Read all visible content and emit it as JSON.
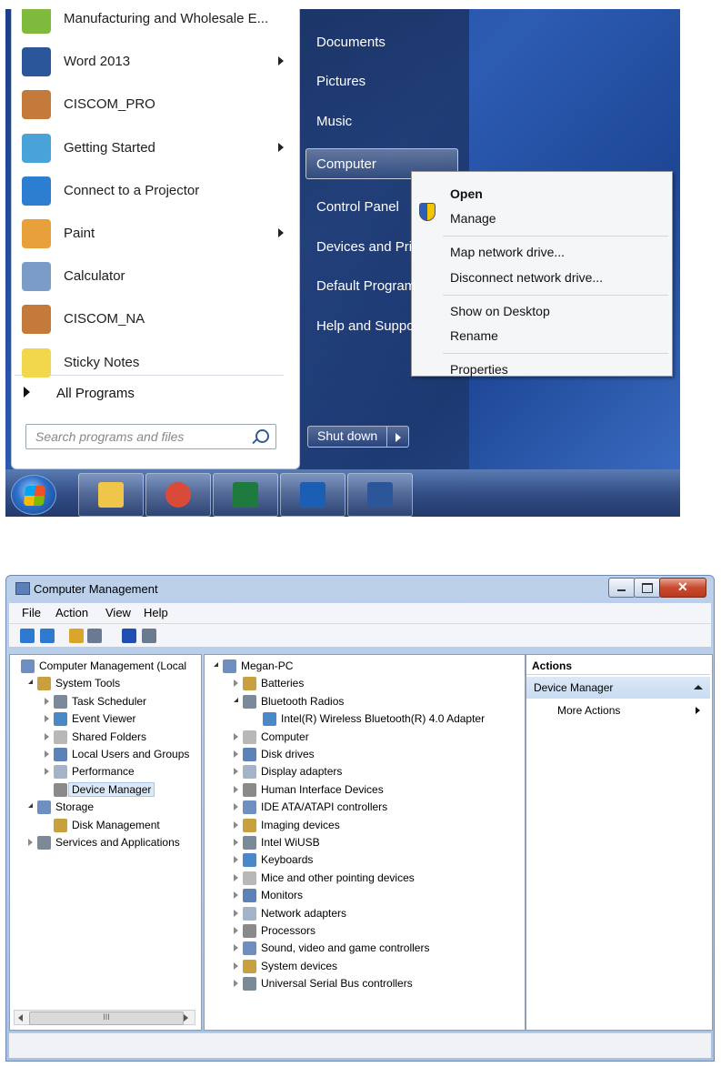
{
  "start_menu": {
    "programs": [
      {
        "label": "Manufacturing and Wholesale E...",
        "icon": "manufacturing-app-icon",
        "arrow": false
      },
      {
        "label": "Word 2013",
        "icon": "word-icon",
        "arrow": true
      },
      {
        "label": "CISCOM_PRO",
        "icon": "ciscom-pro-icon",
        "arrow": false
      },
      {
        "label": "Getting Started",
        "icon": "getting-started-icon",
        "arrow": true
      },
      {
        "label": "Connect to a Projector",
        "icon": "projector-icon",
        "arrow": false
      },
      {
        "label": "Paint",
        "icon": "paint-icon",
        "arrow": true
      },
      {
        "label": "Calculator",
        "icon": "calculator-icon",
        "arrow": false
      },
      {
        "label": "CISCOM_NA",
        "icon": "ciscom-na-icon",
        "arrow": false
      },
      {
        "label": "Sticky Notes",
        "icon": "sticky-notes-icon",
        "arrow": false
      }
    ],
    "all_programs": "All Programs",
    "search_placeholder": "Search programs and files",
    "right_items": [
      "Documents",
      "Pictures",
      "Music",
      "Computer",
      "Control Panel",
      "Devices and Pri",
      "Default Program",
      "Help and Suppo"
    ],
    "shutdown": "Shut down"
  },
  "context_menu": {
    "items": [
      "Open",
      "Manage",
      "Map network drive...",
      "Disconnect network drive...",
      "Show on Desktop",
      "Rename",
      "Properties"
    ]
  },
  "taskbar": {
    "icons": [
      "start-orb-icon",
      "file-explorer-icon",
      "chrome-icon",
      "excel-icon",
      "outlook-icon",
      "word-icon"
    ]
  },
  "computer_management": {
    "title": "Computer Management",
    "menu": [
      "File",
      "Action",
      "View",
      "Help"
    ],
    "tree": [
      {
        "label": "Computer Management (Local",
        "level": 0,
        "exp": "none"
      },
      {
        "label": "System Tools",
        "level": 1,
        "exp": "open"
      },
      {
        "label": "Task Scheduler",
        "level": 2,
        "exp": "closed"
      },
      {
        "label": "Event Viewer",
        "level": 2,
        "exp": "closed"
      },
      {
        "label": "Shared Folders",
        "level": 2,
        "exp": "closed"
      },
      {
        "label": "Local Users and Groups",
        "level": 2,
        "exp": "closed"
      },
      {
        "label": "Performance",
        "level": 2,
        "exp": "closed"
      },
      {
        "label": "Device Manager",
        "level": 2,
        "exp": "none",
        "selected": true
      },
      {
        "label": "Storage",
        "level": 1,
        "exp": "open"
      },
      {
        "label": "Disk Management",
        "level": 2,
        "exp": "none"
      },
      {
        "label": "Services and Applications",
        "level": 1,
        "exp": "closed"
      }
    ],
    "scroll_label": "III",
    "devices": [
      {
        "label": "Megan-PC",
        "level": 0,
        "exp": "open"
      },
      {
        "label": "Batteries",
        "level": 1,
        "exp": "closed"
      },
      {
        "label": "Bluetooth Radios",
        "level": 1,
        "exp": "open"
      },
      {
        "label": "Intel(R) Wireless Bluetooth(R) 4.0 Adapter",
        "level": 2,
        "exp": "none"
      },
      {
        "label": "Computer",
        "level": 1,
        "exp": "closed"
      },
      {
        "label": "Disk drives",
        "level": 1,
        "exp": "closed"
      },
      {
        "label": "Display adapters",
        "level": 1,
        "exp": "closed"
      },
      {
        "label": "Human Interface Devices",
        "level": 1,
        "exp": "closed"
      },
      {
        "label": "IDE ATA/ATAPI controllers",
        "level": 1,
        "exp": "closed"
      },
      {
        "label": "Imaging devices",
        "level": 1,
        "exp": "closed"
      },
      {
        "label": "Intel WiUSB",
        "level": 1,
        "exp": "closed"
      },
      {
        "label": "Keyboards",
        "level": 1,
        "exp": "closed"
      },
      {
        "label": "Mice and other pointing devices",
        "level": 1,
        "exp": "closed"
      },
      {
        "label": "Monitors",
        "level": 1,
        "exp": "closed"
      },
      {
        "label": "Network adapters",
        "level": 1,
        "exp": "closed"
      },
      {
        "label": "Processors",
        "level": 1,
        "exp": "closed"
      },
      {
        "label": "Sound, video and game controllers",
        "level": 1,
        "exp": "closed"
      },
      {
        "label": "System devices",
        "level": 1,
        "exp": "closed"
      },
      {
        "label": "Universal Serial Bus controllers",
        "level": 1,
        "exp": "closed"
      }
    ],
    "actions": {
      "header": "Actions",
      "section": "Device Manager",
      "more": "More Actions"
    }
  }
}
